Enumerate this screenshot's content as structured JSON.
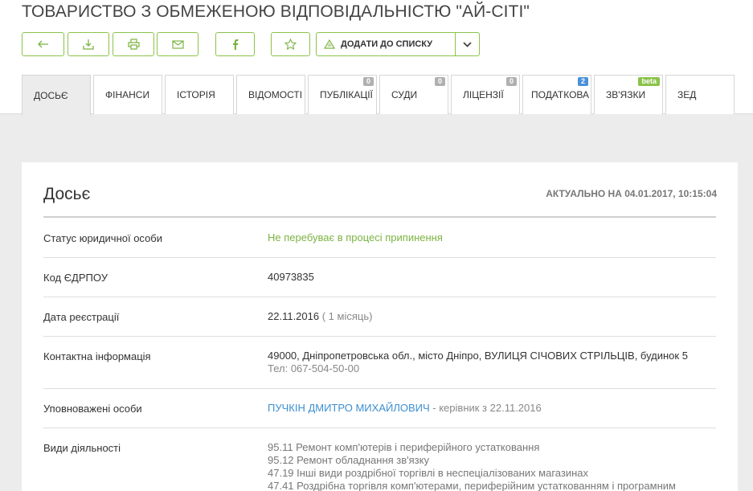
{
  "company": {
    "title": "ТОВАРИСТВО З ОБМЕЖЕНОЮ ВІДПОВІДАЛЬНІСТЮ \"АЙ-СІТІ\""
  },
  "toolbar": {
    "icons": [
      "arrow-left-icon",
      "download-icon",
      "print-icon",
      "mail-icon",
      "facebook-icon",
      "star-icon",
      "list-icon",
      "chevron-down-icon"
    ],
    "add_to_list": "ДОДАТИ ДО СПИСКУ"
  },
  "tabs": [
    {
      "label": "ДОСЬЄ",
      "badge": ""
    },
    {
      "label": "ФІНАНСИ",
      "badge": ""
    },
    {
      "label": "ІСТОРІЯ",
      "badge": ""
    },
    {
      "label": "ВІДОМОСТІ",
      "badge": ""
    },
    {
      "label": "ПУБЛІКАЦІЇ",
      "badge": "0"
    },
    {
      "label": "СУДИ",
      "badge": "0"
    },
    {
      "label": "ЛІЦЕНЗІЇ",
      "badge": "0"
    },
    {
      "label": "ПОДАТКОВА",
      "badge": "2"
    },
    {
      "label": "ЗВ'ЯЗКИ",
      "badge": "beta"
    },
    {
      "label": "ЗЕД",
      "badge": ""
    }
  ],
  "colors": {
    "accent": "#7cb342",
    "link": "#3d8fd1",
    "badge_blue": "#4a90d9"
  },
  "dossier": {
    "title": "Досьє",
    "updated": "АКТУАЛЬНО НА 04.01.2017, 10:15:04",
    "status": {
      "label": "Статус юридичної особи",
      "value": "Не перебуває в процесі припинення"
    },
    "edrpou": {
      "label": "Код ЄДРПОУ",
      "value": "40973835"
    },
    "registration": {
      "label": "Дата реєстрації",
      "date": "22.11.2016",
      "age": "( 1 місяць)"
    },
    "contact": {
      "label": "Контактна інформація",
      "address": "49000, Дніпропетровська обл., місто Дніпро, ВУЛИЦЯ СІЧОВИХ СТРІЛЬЦІВ, будинок 5",
      "phone": "Тел: 067-504-50-00"
    },
    "authorized": {
      "label": "Уповноважені особи",
      "name": "ПУЧКІН ДМИТРО МИХАЙЛОВИЧ",
      "role": " - керівник з 22.11.2016"
    },
    "activities": {
      "label": "Види діяльності",
      "items": [
        "95.11 Ремонт комп'ютерів і периферійного устатковання",
        "95.12 Ремонт обладнання зв'язку",
        "47.19 Інші види роздрібної торгівлі в неспеціалізованих магазинах",
        "47.41 Роздрібна торгівля комп'ютерами, периферійним устаткованням і програмним"
      ]
    }
  }
}
